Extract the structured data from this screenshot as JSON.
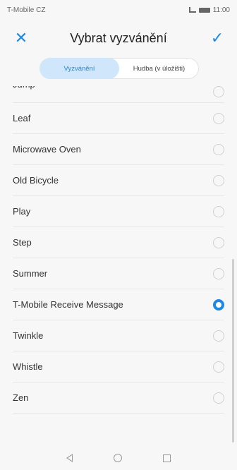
{
  "status_bar": {
    "carrier": "T-Mobile CZ",
    "time": "11:00"
  },
  "header": {
    "title": "Vybrat vyzvánění"
  },
  "tabs": [
    {
      "label": "Vyzvánění",
      "active": true
    },
    {
      "label": "Hudba (v úložišti)",
      "active": false
    }
  ],
  "ringtones": [
    {
      "label": "Jump",
      "selected": false,
      "partial": true
    },
    {
      "label": "Leaf",
      "selected": false
    },
    {
      "label": "Microwave Oven",
      "selected": false
    },
    {
      "label": "Old Bicycle",
      "selected": false
    },
    {
      "label": "Play",
      "selected": false
    },
    {
      "label": "Step",
      "selected": false
    },
    {
      "label": "Summer",
      "selected": false
    },
    {
      "label": "T-Mobile Receive Message",
      "selected": true
    },
    {
      "label": "Twinkle",
      "selected": false
    },
    {
      "label": "Whistle",
      "selected": false
    },
    {
      "label": "Zen",
      "selected": false
    }
  ],
  "icons": {
    "close": "close-icon",
    "confirm": "check-icon",
    "back": "nav-back-icon",
    "home": "nav-home-icon",
    "recent": "nav-recent-icon"
  },
  "colors": {
    "accent": "#1e88e5",
    "tab_active_bg": "#cfe6fb"
  }
}
